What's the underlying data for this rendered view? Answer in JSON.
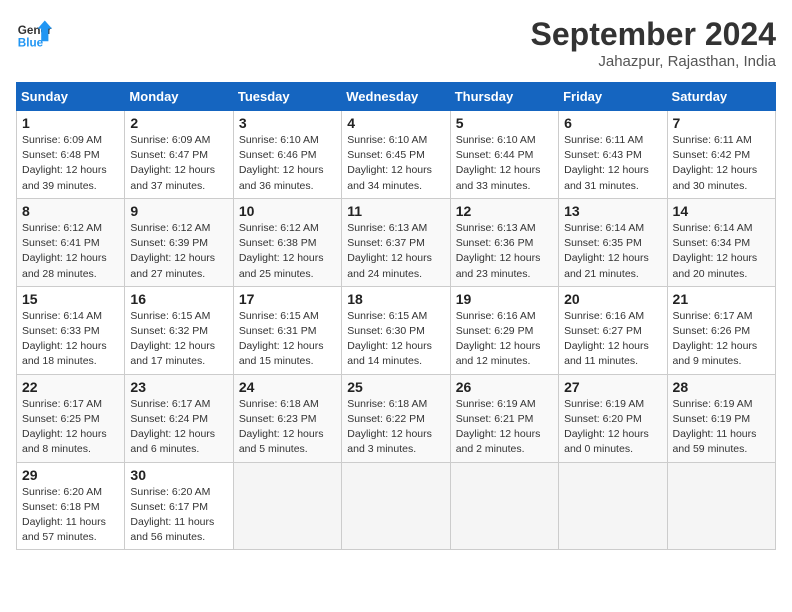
{
  "logo": {
    "line1": "General",
    "line2": "Blue"
  },
  "title": "September 2024",
  "location": "Jahazpur, Rajasthan, India",
  "weekdays": [
    "Sunday",
    "Monday",
    "Tuesday",
    "Wednesday",
    "Thursday",
    "Friday",
    "Saturday"
  ],
  "weeks": [
    [
      {
        "day": "1",
        "info": "Sunrise: 6:09 AM\nSunset: 6:48 PM\nDaylight: 12 hours\nand 39 minutes."
      },
      {
        "day": "2",
        "info": "Sunrise: 6:09 AM\nSunset: 6:47 PM\nDaylight: 12 hours\nand 37 minutes."
      },
      {
        "day": "3",
        "info": "Sunrise: 6:10 AM\nSunset: 6:46 PM\nDaylight: 12 hours\nand 36 minutes."
      },
      {
        "day": "4",
        "info": "Sunrise: 6:10 AM\nSunset: 6:45 PM\nDaylight: 12 hours\nand 34 minutes."
      },
      {
        "day": "5",
        "info": "Sunrise: 6:10 AM\nSunset: 6:44 PM\nDaylight: 12 hours\nand 33 minutes."
      },
      {
        "day": "6",
        "info": "Sunrise: 6:11 AM\nSunset: 6:43 PM\nDaylight: 12 hours\nand 31 minutes."
      },
      {
        "day": "7",
        "info": "Sunrise: 6:11 AM\nSunset: 6:42 PM\nDaylight: 12 hours\nand 30 minutes."
      }
    ],
    [
      {
        "day": "8",
        "info": "Sunrise: 6:12 AM\nSunset: 6:41 PM\nDaylight: 12 hours\nand 28 minutes."
      },
      {
        "day": "9",
        "info": "Sunrise: 6:12 AM\nSunset: 6:39 PM\nDaylight: 12 hours\nand 27 minutes."
      },
      {
        "day": "10",
        "info": "Sunrise: 6:12 AM\nSunset: 6:38 PM\nDaylight: 12 hours\nand 25 minutes."
      },
      {
        "day": "11",
        "info": "Sunrise: 6:13 AM\nSunset: 6:37 PM\nDaylight: 12 hours\nand 24 minutes."
      },
      {
        "day": "12",
        "info": "Sunrise: 6:13 AM\nSunset: 6:36 PM\nDaylight: 12 hours\nand 23 minutes."
      },
      {
        "day": "13",
        "info": "Sunrise: 6:14 AM\nSunset: 6:35 PM\nDaylight: 12 hours\nand 21 minutes."
      },
      {
        "day": "14",
        "info": "Sunrise: 6:14 AM\nSunset: 6:34 PM\nDaylight: 12 hours\nand 20 minutes."
      }
    ],
    [
      {
        "day": "15",
        "info": "Sunrise: 6:14 AM\nSunset: 6:33 PM\nDaylight: 12 hours\nand 18 minutes."
      },
      {
        "day": "16",
        "info": "Sunrise: 6:15 AM\nSunset: 6:32 PM\nDaylight: 12 hours\nand 17 minutes."
      },
      {
        "day": "17",
        "info": "Sunrise: 6:15 AM\nSunset: 6:31 PM\nDaylight: 12 hours\nand 15 minutes."
      },
      {
        "day": "18",
        "info": "Sunrise: 6:15 AM\nSunset: 6:30 PM\nDaylight: 12 hours\nand 14 minutes."
      },
      {
        "day": "19",
        "info": "Sunrise: 6:16 AM\nSunset: 6:29 PM\nDaylight: 12 hours\nand 12 minutes."
      },
      {
        "day": "20",
        "info": "Sunrise: 6:16 AM\nSunset: 6:27 PM\nDaylight: 12 hours\nand 11 minutes."
      },
      {
        "day": "21",
        "info": "Sunrise: 6:17 AM\nSunset: 6:26 PM\nDaylight: 12 hours\nand 9 minutes."
      }
    ],
    [
      {
        "day": "22",
        "info": "Sunrise: 6:17 AM\nSunset: 6:25 PM\nDaylight: 12 hours\nand 8 minutes."
      },
      {
        "day": "23",
        "info": "Sunrise: 6:17 AM\nSunset: 6:24 PM\nDaylight: 12 hours\nand 6 minutes."
      },
      {
        "day": "24",
        "info": "Sunrise: 6:18 AM\nSunset: 6:23 PM\nDaylight: 12 hours\nand 5 minutes."
      },
      {
        "day": "25",
        "info": "Sunrise: 6:18 AM\nSunset: 6:22 PM\nDaylight: 12 hours\nand 3 minutes."
      },
      {
        "day": "26",
        "info": "Sunrise: 6:19 AM\nSunset: 6:21 PM\nDaylight: 12 hours\nand 2 minutes."
      },
      {
        "day": "27",
        "info": "Sunrise: 6:19 AM\nSunset: 6:20 PM\nDaylight: 12 hours\nand 0 minutes."
      },
      {
        "day": "28",
        "info": "Sunrise: 6:19 AM\nSunset: 6:19 PM\nDaylight: 11 hours\nand 59 minutes."
      }
    ],
    [
      {
        "day": "29",
        "info": "Sunrise: 6:20 AM\nSunset: 6:18 PM\nDaylight: 11 hours\nand 57 minutes."
      },
      {
        "day": "30",
        "info": "Sunrise: 6:20 AM\nSunset: 6:17 PM\nDaylight: 11 hours\nand 56 minutes."
      },
      null,
      null,
      null,
      null,
      null
    ]
  ]
}
